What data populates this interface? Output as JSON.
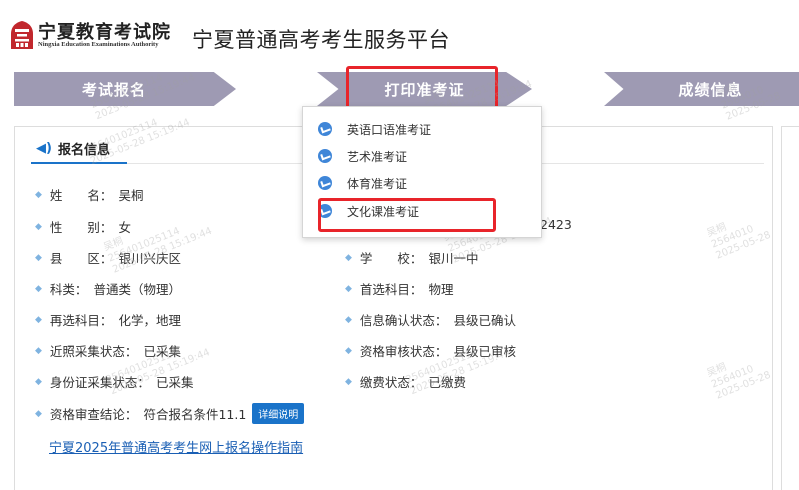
{
  "header": {
    "org_name_cn": "宁夏教育考试院",
    "org_name_en": "Ningxia Education Examinations Authority",
    "platform_title": "宁夏普通高考考生服务平台",
    "logo_icon": "institution-logo-icon"
  },
  "steps": [
    {
      "label": "考试报名"
    },
    {
      "label": "打印准考证"
    },
    {
      "label": "成绩信息"
    }
  ],
  "dropdown": {
    "items": [
      {
        "label": "英语口语准考证",
        "icon": "check-circle-icon"
      },
      {
        "label": "艺术准考证",
        "icon": "check-circle-icon"
      },
      {
        "label": "体育准考证",
        "icon": "check-circle-icon"
      },
      {
        "label": "文化课准考证",
        "icon": "check-circle-icon"
      }
    ]
  },
  "section": {
    "title": "报名信息",
    "speaker_icon": "speaker-icon"
  },
  "left_fields": [
    {
      "label": "姓　　名：",
      "value": "吴桐"
    },
    {
      "label": "性　　别：",
      "value": "女"
    },
    {
      "label": "县　　区：",
      "value": "银川兴庆区"
    },
    {
      "label": "科类：",
      "value": "普通类（物理）"
    },
    {
      "label": "再选科目：",
      "value": "化学，地理"
    },
    {
      "label": "近照采集状态：",
      "value": "已采集"
    },
    {
      "label": "身份证采集状态：",
      "value": "已采集"
    },
    {
      "label": "资格审查结论：",
      "value": "符合报名条件11.1"
    }
  ],
  "right_fields": [
    {
      "label": "",
      "value": "2423"
    },
    {
      "label": "学　　校：",
      "value": "银川一中"
    },
    {
      "label": "首选科目：",
      "value": "物理"
    },
    {
      "label": "信息确认状态：",
      "value": "县级已确认"
    },
    {
      "label": "资格审核状态：",
      "value": "县级已审核"
    },
    {
      "label": "缴费状态：",
      "value": "已缴费"
    }
  ],
  "detail_button": "详细说明",
  "guide_link": "宁夏2025年普通高考考生网上报名操作指南",
  "watermark": {
    "id": "256401025114",
    "time": "2025-05-28 15:19:44",
    "name": "吴桐",
    "id_partial": "2564010",
    "date_partial": "2025-05-28"
  },
  "colors": {
    "step_bg": "#9e9ab3",
    "highlight": "#e8242a",
    "accent": "#1a73c9"
  }
}
